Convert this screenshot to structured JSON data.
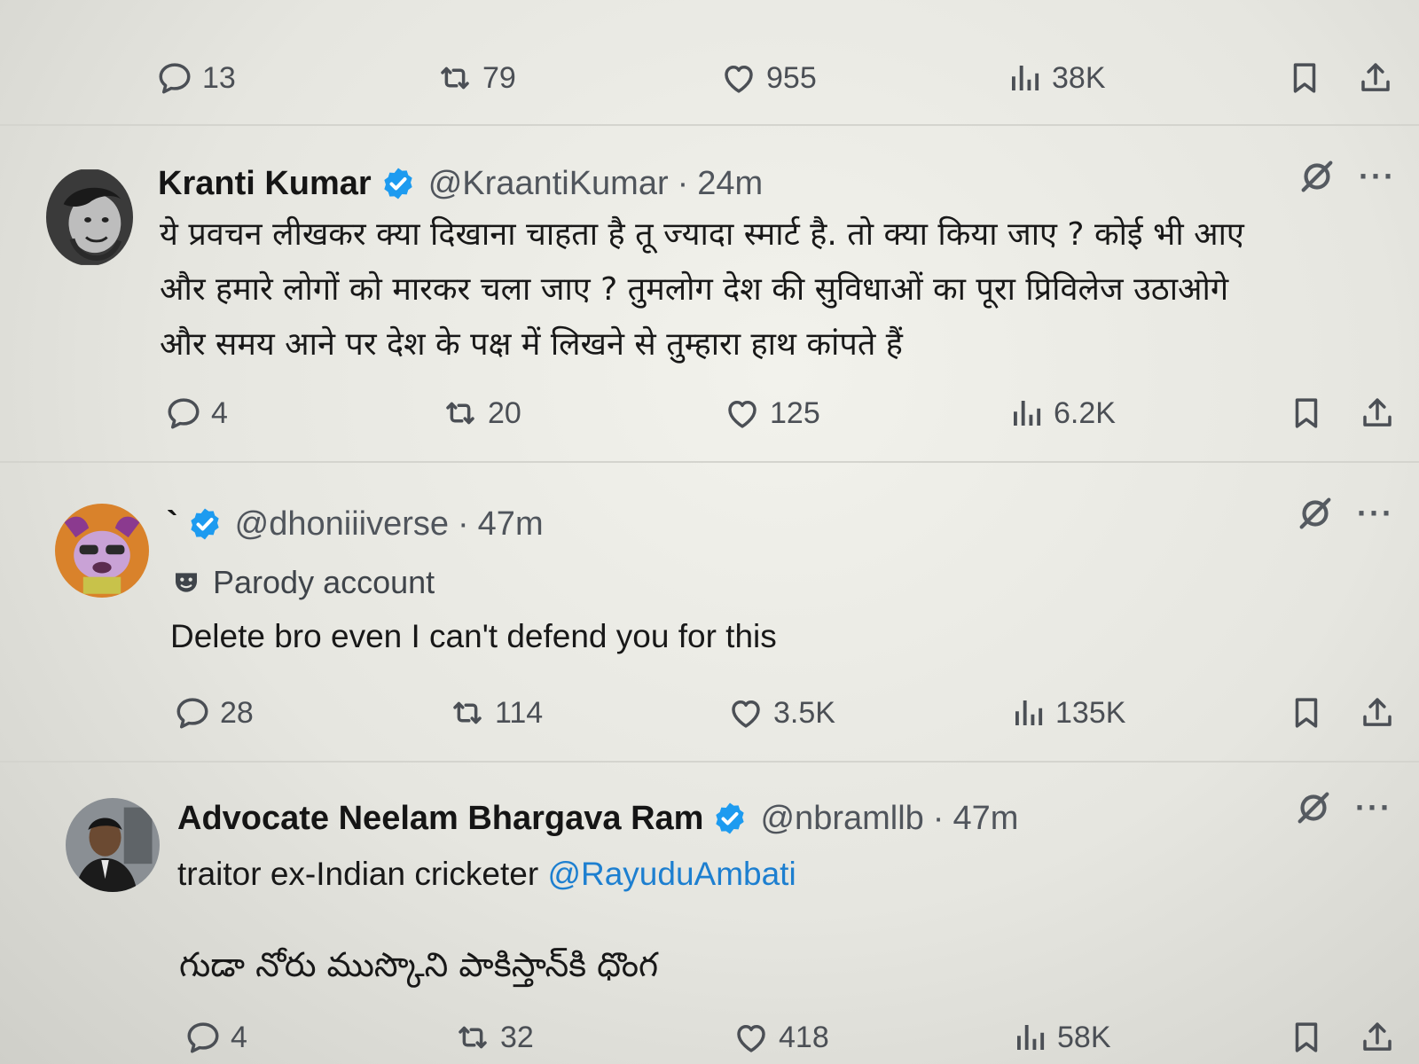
{
  "top_post": {
    "actions": {
      "replies": "13",
      "reposts": "79",
      "likes": "955",
      "views": "38K"
    }
  },
  "replies": [
    {
      "display_name": "Kranti Kumar",
      "handle": "@KraantiKumar",
      "separator": "·",
      "time": "24m",
      "text_lines": [
        "ये प्रवचन लीखकर क्या दिखाना चाहता है तू ज्यादा स्मार्ट है. तो क्या किया जाए ? कोई भी आए",
        "और हमारे लोगों को मारकर चला जाए ? तुमलोग देश की सुविधाओं का पूरा प्रिविलेज उठाओगे",
        "और समय आने पर देश के पक्ष में लिखने से तुम्हारा हाथ कांपते हैं"
      ],
      "actions": {
        "replies": "4",
        "reposts": "20",
        "likes": "125",
        "views": "6.2K"
      }
    },
    {
      "display_name": "`",
      "handle": "@dhoniiiverse",
      "separator": "·",
      "time": "47m",
      "label": "Parody account",
      "text": "Delete bro even I can't defend you for this",
      "actions": {
        "replies": "28",
        "reposts": "114",
        "likes": "3.5K",
        "views": "135K"
      }
    },
    {
      "display_name": "Advocate Neelam Bhargava Ram",
      "handle": "@nbramllb",
      "separator": "·",
      "time": "47m",
      "text_prefix": "traitor ex-Indian cricketer",
      "mention": "@RayuduAmbati",
      "telugu_text": "గుడా నోరు ముస్కొని పాకిస్తాన్‌కి ధొంగ",
      "actions": {
        "replies": "4",
        "reposts": "32",
        "likes": "418",
        "views": "58K"
      }
    }
  ],
  "icons": {
    "reply": "reply-icon",
    "repost": "repost-icon",
    "like": "heart-icon",
    "views": "views-icon",
    "bookmark": "bookmark-icon",
    "share": "share-icon",
    "grok": "grok-icon",
    "more": "more-icon",
    "verified": "verified-badge-icon",
    "parody": "parody-mask-icon"
  },
  "colors": {
    "verified": "#1d9bf0",
    "mention": "#1d7fd0",
    "meta": "#50555c"
  },
  "more_glyph": "···"
}
